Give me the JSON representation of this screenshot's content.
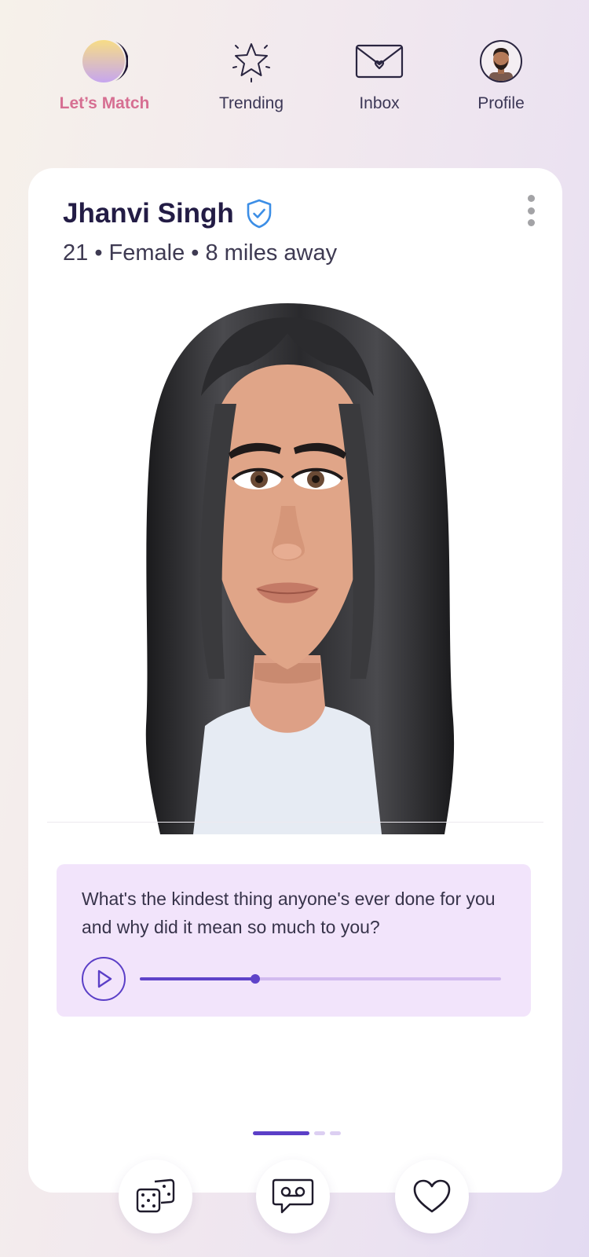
{
  "nav": {
    "items": [
      {
        "label": "Let’s Match",
        "icon": "moon-icon",
        "active": true
      },
      {
        "label": "Trending",
        "icon": "star-icon",
        "active": false
      },
      {
        "label": "Inbox",
        "icon": "envelope-heart-icon",
        "active": false
      },
      {
        "label": "Profile",
        "icon": "user-avatar-icon",
        "active": false
      }
    ]
  },
  "profile": {
    "name": "Jhanvi Singh",
    "verified": true,
    "meta": "21 • Female • 8 miles away"
  },
  "prompt": {
    "question": "What's the kindest thing anyone's ever done for you and why did it mean so much to you?",
    "audio_progress": 0.32
  },
  "pager": {
    "pages": 3,
    "current": 1
  },
  "actions": [
    {
      "name": "dice-button",
      "icon": "dice-icon"
    },
    {
      "name": "voice-message-button",
      "icon": "voicemail-chat-icon"
    },
    {
      "name": "like-button",
      "icon": "heart-icon"
    }
  ],
  "colors": {
    "accent": "#5b3fc7",
    "active_nav": "#d66f92",
    "prompt_bg": "#f2e4fb",
    "verified": "#3c8ee6"
  }
}
